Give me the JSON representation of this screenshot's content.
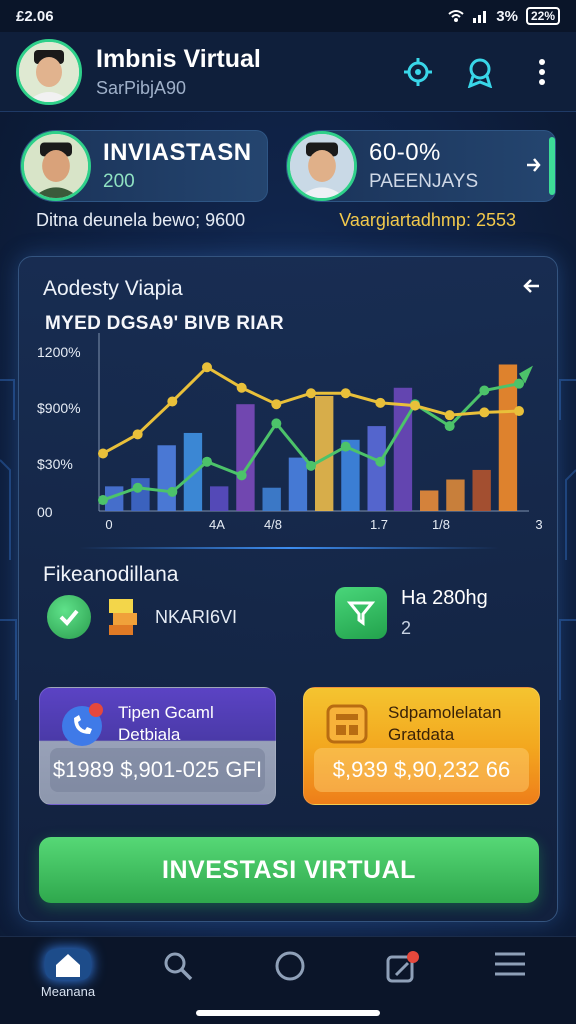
{
  "status_bar": {
    "time": "£2.06",
    "battery": "22%",
    "signal_text": "3%"
  },
  "header": {
    "title": "Imbnis Virtual",
    "subtitle": "SarPibjA90",
    "icons": [
      "gear-icon",
      "badge-icon",
      "more-vertical-icon"
    ]
  },
  "summary": {
    "card_a": {
      "main": "INVIASTASN",
      "sub": "200"
    },
    "card_b": {
      "main": "60-0%",
      "sub": "PAEENJAYS"
    },
    "caption_a": "Ditna deunela bewo; 9600",
    "caption_b": "Vaargiartadhmp: 2553"
  },
  "chart_panel": {
    "title": "Aodesty Viapia",
    "banner": "MYED DGSA9' BIVB RIAR",
    "chart_data": {
      "type": "bar",
      "ytick_labels": [
        "1200%",
        "$900%",
        "$30%",
        "00"
      ],
      "xtick_labels": [
        "0",
        "4A",
        "4/8",
        "1.7",
        "1/8",
        "3"
      ],
      "ylim": [
        0,
        1300
      ],
      "bars": [
        {
          "value": 180,
          "color": "#4a74d6"
        },
        {
          "value": 240,
          "color": "#3f67c8"
        },
        {
          "value": 480,
          "color": "#4f7fe0"
        },
        {
          "value": 570,
          "color": "#3f8fe0"
        },
        {
          "value": 180,
          "color": "#5a4cc0"
        },
        {
          "value": 780,
          "color": "#7a4ab8"
        },
        {
          "value": 170,
          "color": "#3f7fd0"
        },
        {
          "value": 390,
          "color": "#4a80e0"
        },
        {
          "value": 840,
          "color": "#e8b84a"
        },
        {
          "value": 520,
          "color": "#3f86e0"
        },
        {
          "value": 620,
          "color": "#5a6ad8"
        },
        {
          "value": 900,
          "color": "#6a48b8"
        },
        {
          "value": 150,
          "color": "#e58a3a"
        },
        {
          "value": 230,
          "color": "#d8873a"
        },
        {
          "value": 300,
          "color": "#b0532e"
        },
        {
          "value": 1070,
          "color": "#f08a2a"
        }
      ],
      "series": [
        {
          "color": "#4cc36a",
          "values": [
            80,
            170,
            140,
            360,
            260,
            640,
            330,
            470,
            360,
            780,
            620,
            880,
            930
          ]
        },
        {
          "color": "#e9c03a",
          "values": [
            420,
            560,
            800,
            1050,
            900,
            780,
            860,
            860,
            790,
            770,
            700,
            720,
            730
          ]
        }
      ]
    }
  },
  "features": {
    "title": "Fikeanodillana",
    "left_label": "NKARI6VI",
    "right_value": "Ha 280hg",
    "right_sub": "2"
  },
  "actions": {
    "left": {
      "title_line1": "Tipen Gcaml",
      "title_line2": "Detbiala",
      "amount": "$1989 $,901-025 GFI"
    },
    "right": {
      "title_line1": "Sdpamolelatan",
      "title_line2": "Gratdata",
      "amount": "$,939 $,90,232 66"
    }
  },
  "cta": {
    "label": "INVESTASI VIRTUAL"
  },
  "bottom_nav": {
    "home_label": "Meanana",
    "items": [
      "home-icon",
      "search-icon",
      "circle-icon",
      "notification-icon",
      "menu-icon"
    ]
  },
  "colors": {
    "accent_green": "#3ddc97",
    "cta_green": "#3cb85a",
    "panel_bg": "#182d52",
    "highlight_yellow": "#f2c94c"
  }
}
